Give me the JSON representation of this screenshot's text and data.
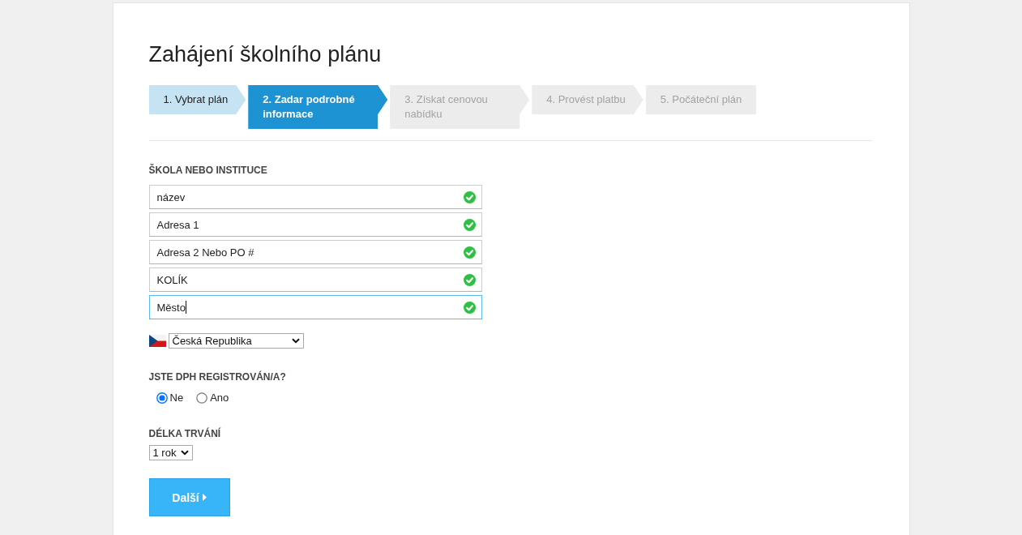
{
  "title": "Zahájení školního plánu",
  "steps": [
    {
      "label": "1. Vybrat plán",
      "selected": false,
      "completed": true
    },
    {
      "label": "2. Zadar podrobné informace",
      "selected": true,
      "completed": false
    },
    {
      "label": "3. Získat cenovou nabídku",
      "selected": false,
      "completed": false
    },
    {
      "label": "4. Provést platbu",
      "selected": false,
      "completed": false
    },
    {
      "label": "5. Počáteční plán",
      "selected": false,
      "completed": false
    }
  ],
  "school": {
    "heading": "ŠKOLA NEBO INSTITUCE",
    "fields": [
      {
        "value": "název",
        "valid": true,
        "focused": false
      },
      {
        "value": "Adresa 1",
        "valid": true,
        "focused": false
      },
      {
        "value": "Adresa 2 Nebo PO #",
        "valid": true,
        "focused": false
      },
      {
        "value": "KOLÍK",
        "valid": true,
        "focused": false
      },
      {
        "value": "Město",
        "valid": true,
        "focused": true
      }
    ],
    "country": {
      "value": "Česká Republika"
    }
  },
  "vat": {
    "heading": "JSTE DPH REGISTROVÁN/A?",
    "options": [
      {
        "label": "Ne",
        "selected": true
      },
      {
        "label": "Ano",
        "selected": false
      }
    ]
  },
  "duration": {
    "heading": "DÉLKA TRVÁNÍ",
    "value": "1 rok"
  },
  "next_button": {
    "label": "Další"
  }
}
